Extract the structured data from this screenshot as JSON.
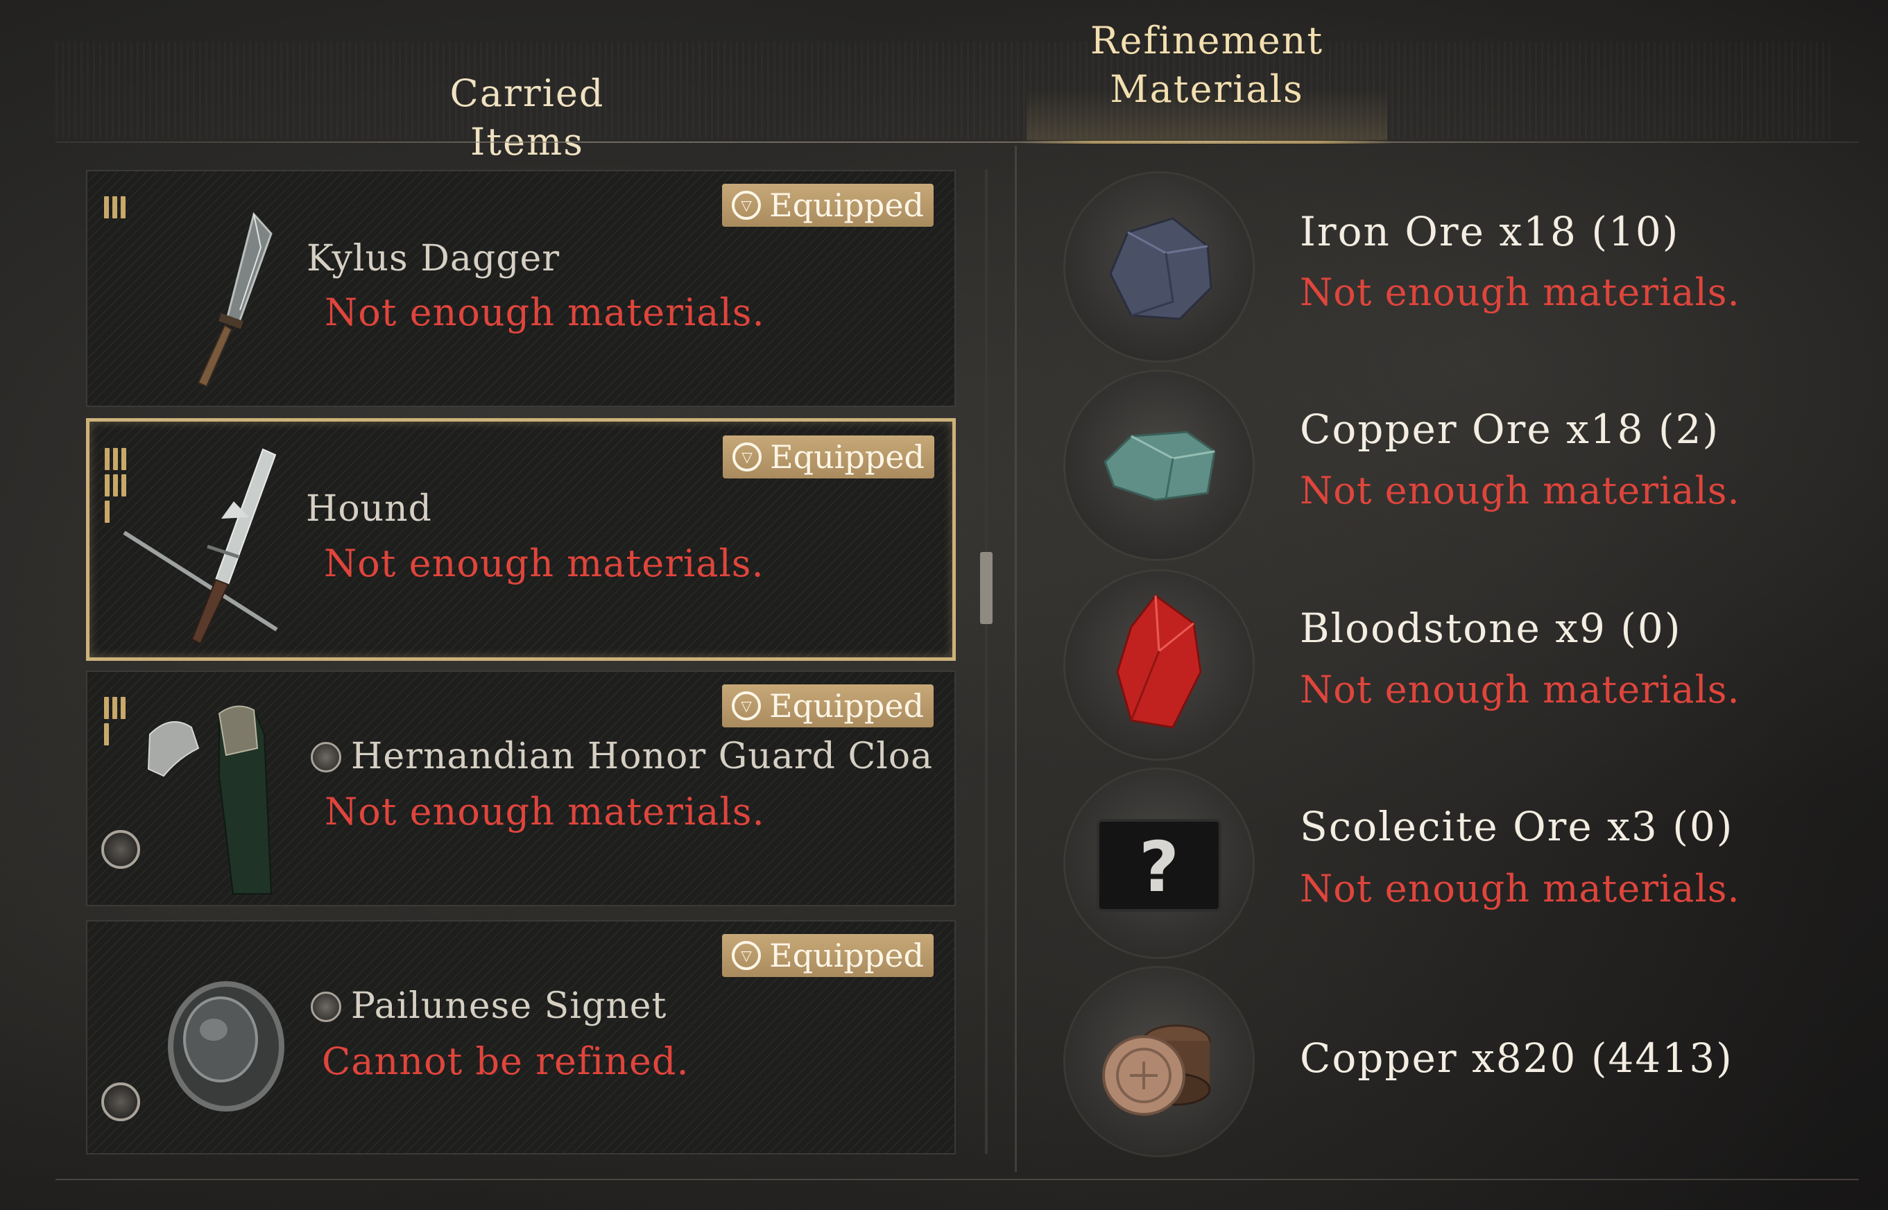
{
  "tabs": {
    "carried_items": "Carried Items",
    "refinement_line1": "Refinement",
    "refinement_line2": "Materials"
  },
  "items": [
    {
      "name": "Kylus Dagger",
      "status": "Not enough materials.",
      "badge": "Equipped",
      "tier_icon": "tier-3-icon",
      "art_icon": "dagger-icon"
    },
    {
      "name": "Hound",
      "status": "Not enough materials.",
      "badge": "Equipped",
      "tier_icon": "tier-7-icon",
      "art_icon": "sword-icon"
    },
    {
      "name": "Hernandian Honor Guard Cloa",
      "status": "Not enough materials.",
      "badge": "Equipped",
      "tier_icon": "tier-4-icon",
      "art_icon": "cloak-icon"
    },
    {
      "name": "Pailunese Signet",
      "status": "Cannot be refined.",
      "badge": "Equipped",
      "tier_icon": "",
      "art_icon": "ring-icon"
    }
  ],
  "materials": [
    {
      "name": "Iron Ore x18 (10)",
      "status": "Not enough materials.",
      "icon": "iron-ore-icon"
    },
    {
      "name": "Copper Ore x18 (2)",
      "status": "Not enough materials.",
      "icon": "copper-ore-icon"
    },
    {
      "name": "Bloodstone x9 (0)",
      "status": "Not enough materials.",
      "icon": "bloodstone-icon"
    },
    {
      "name": "Scolecite Ore x3 (0)",
      "status": "Not enough materials.",
      "icon": "unknown-item-icon"
    },
    {
      "name": "Copper x820 (4413)",
      "status": "",
      "icon": "copper-coins-icon"
    }
  ],
  "colors": {
    "accent_gold": "#cdb27a",
    "badge_bg": "#b89a6a",
    "error_red": "#e0453c",
    "text_light": "#f3ede2"
  }
}
